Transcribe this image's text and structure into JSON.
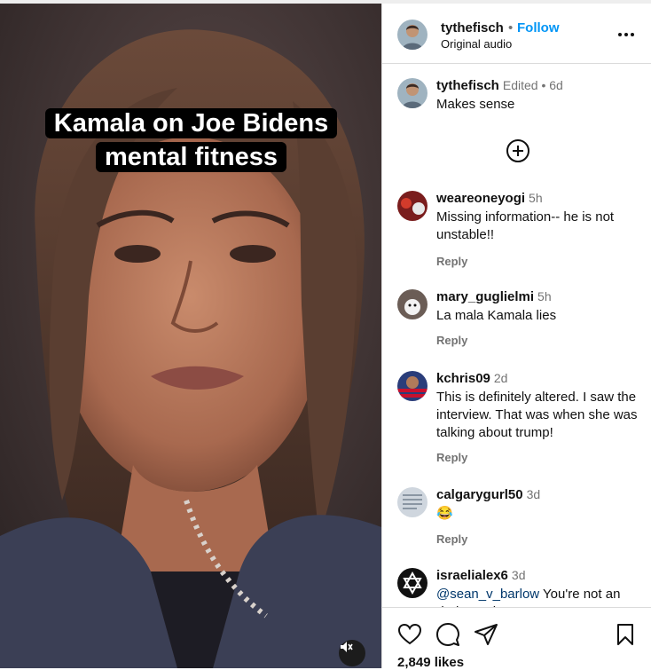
{
  "video": {
    "caption_line1": "Kamala on Joe Bidens",
    "caption_line2": "mental fitness",
    "mute_icon": "muted-speaker-icon"
  },
  "header": {
    "username": "tythefisch",
    "separator": "•",
    "follow_label": "Follow",
    "audio_label": "Original audio",
    "more_icon": "more-options-icon"
  },
  "caption_comment": {
    "username": "tythefisch",
    "meta": "Edited •  6d",
    "text": "Makes sense"
  },
  "add_icon": "plus-circle-icon",
  "comments": [
    {
      "username": "weareoneyogi",
      "time": "5h",
      "text": "Missing information-- he is not unstable!!",
      "reply": "Reply"
    },
    {
      "username": "mary_guglielmi",
      "time": "5h",
      "text": "La mala Kamala lies",
      "reply": "Reply"
    },
    {
      "username": "kchris09",
      "time": "2d",
      "text": "This is definitely altered. I saw the interview. That was when she was talking about trump!",
      "reply": "Reply"
    },
    {
      "username": "calgarygurl50",
      "time": "3d",
      "text": "😂",
      "reply": "Reply"
    },
    {
      "username": "israelialex6",
      "time": "3d",
      "mention": "@sean_v_barlow",
      "text": " You're not an \"independent\". You're a..."
    }
  ],
  "actions": {
    "like_icon": "heart-icon",
    "comment_icon": "comment-icon",
    "share_icon": "send-icon",
    "save_icon": "bookmark-icon",
    "likes": "2,849 likes"
  }
}
